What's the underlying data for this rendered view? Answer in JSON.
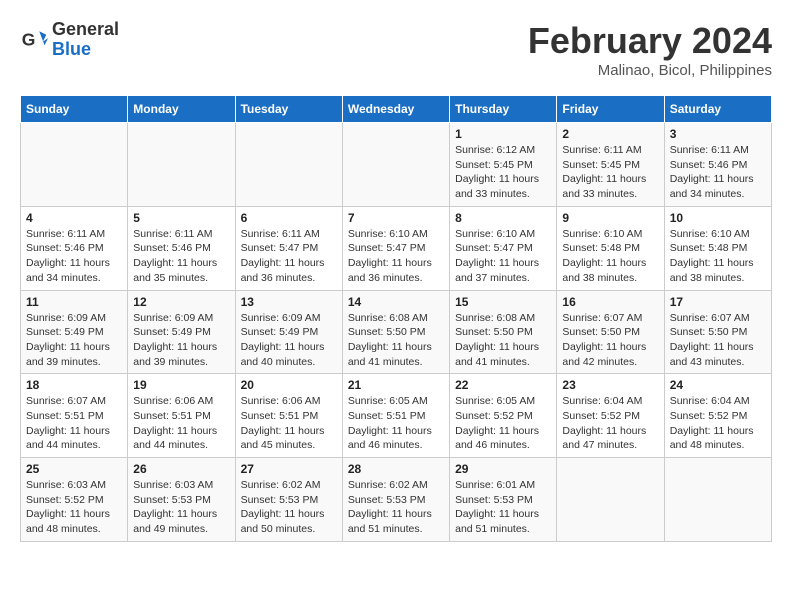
{
  "header": {
    "logo_line1": "General",
    "logo_line2": "Blue",
    "main_title": "February 2024",
    "subtitle": "Malinao, Bicol, Philippines"
  },
  "calendar": {
    "days_of_week": [
      "Sunday",
      "Monday",
      "Tuesday",
      "Wednesday",
      "Thursday",
      "Friday",
      "Saturday"
    ],
    "weeks": [
      [
        {
          "day": "",
          "details": ""
        },
        {
          "day": "",
          "details": ""
        },
        {
          "day": "",
          "details": ""
        },
        {
          "day": "",
          "details": ""
        },
        {
          "day": "1",
          "details": "Sunrise: 6:12 AM\nSunset: 5:45 PM\nDaylight: 11 hours and 33 minutes."
        },
        {
          "day": "2",
          "details": "Sunrise: 6:11 AM\nSunset: 5:45 PM\nDaylight: 11 hours and 33 minutes."
        },
        {
          "day": "3",
          "details": "Sunrise: 6:11 AM\nSunset: 5:46 PM\nDaylight: 11 hours and 34 minutes."
        }
      ],
      [
        {
          "day": "4",
          "details": "Sunrise: 6:11 AM\nSunset: 5:46 PM\nDaylight: 11 hours and 34 minutes."
        },
        {
          "day": "5",
          "details": "Sunrise: 6:11 AM\nSunset: 5:46 PM\nDaylight: 11 hours and 35 minutes."
        },
        {
          "day": "6",
          "details": "Sunrise: 6:11 AM\nSunset: 5:47 PM\nDaylight: 11 hours and 36 minutes."
        },
        {
          "day": "7",
          "details": "Sunrise: 6:10 AM\nSunset: 5:47 PM\nDaylight: 11 hours and 36 minutes."
        },
        {
          "day": "8",
          "details": "Sunrise: 6:10 AM\nSunset: 5:47 PM\nDaylight: 11 hours and 37 minutes."
        },
        {
          "day": "9",
          "details": "Sunrise: 6:10 AM\nSunset: 5:48 PM\nDaylight: 11 hours and 38 minutes."
        },
        {
          "day": "10",
          "details": "Sunrise: 6:10 AM\nSunset: 5:48 PM\nDaylight: 11 hours and 38 minutes."
        }
      ],
      [
        {
          "day": "11",
          "details": "Sunrise: 6:09 AM\nSunset: 5:49 PM\nDaylight: 11 hours and 39 minutes."
        },
        {
          "day": "12",
          "details": "Sunrise: 6:09 AM\nSunset: 5:49 PM\nDaylight: 11 hours and 39 minutes."
        },
        {
          "day": "13",
          "details": "Sunrise: 6:09 AM\nSunset: 5:49 PM\nDaylight: 11 hours and 40 minutes."
        },
        {
          "day": "14",
          "details": "Sunrise: 6:08 AM\nSunset: 5:50 PM\nDaylight: 11 hours and 41 minutes."
        },
        {
          "day": "15",
          "details": "Sunrise: 6:08 AM\nSunset: 5:50 PM\nDaylight: 11 hours and 41 minutes."
        },
        {
          "day": "16",
          "details": "Sunrise: 6:07 AM\nSunset: 5:50 PM\nDaylight: 11 hours and 42 minutes."
        },
        {
          "day": "17",
          "details": "Sunrise: 6:07 AM\nSunset: 5:50 PM\nDaylight: 11 hours and 43 minutes."
        }
      ],
      [
        {
          "day": "18",
          "details": "Sunrise: 6:07 AM\nSunset: 5:51 PM\nDaylight: 11 hours and 44 minutes."
        },
        {
          "day": "19",
          "details": "Sunrise: 6:06 AM\nSunset: 5:51 PM\nDaylight: 11 hours and 44 minutes."
        },
        {
          "day": "20",
          "details": "Sunrise: 6:06 AM\nSunset: 5:51 PM\nDaylight: 11 hours and 45 minutes."
        },
        {
          "day": "21",
          "details": "Sunrise: 6:05 AM\nSunset: 5:51 PM\nDaylight: 11 hours and 46 minutes."
        },
        {
          "day": "22",
          "details": "Sunrise: 6:05 AM\nSunset: 5:52 PM\nDaylight: 11 hours and 46 minutes."
        },
        {
          "day": "23",
          "details": "Sunrise: 6:04 AM\nSunset: 5:52 PM\nDaylight: 11 hours and 47 minutes."
        },
        {
          "day": "24",
          "details": "Sunrise: 6:04 AM\nSunset: 5:52 PM\nDaylight: 11 hours and 48 minutes."
        }
      ],
      [
        {
          "day": "25",
          "details": "Sunrise: 6:03 AM\nSunset: 5:52 PM\nDaylight: 11 hours and 48 minutes."
        },
        {
          "day": "26",
          "details": "Sunrise: 6:03 AM\nSunset: 5:53 PM\nDaylight: 11 hours and 49 minutes."
        },
        {
          "day": "27",
          "details": "Sunrise: 6:02 AM\nSunset: 5:53 PM\nDaylight: 11 hours and 50 minutes."
        },
        {
          "day": "28",
          "details": "Sunrise: 6:02 AM\nSunset: 5:53 PM\nDaylight: 11 hours and 51 minutes."
        },
        {
          "day": "29",
          "details": "Sunrise: 6:01 AM\nSunset: 5:53 PM\nDaylight: 11 hours and 51 minutes."
        },
        {
          "day": "",
          "details": ""
        },
        {
          "day": "",
          "details": ""
        }
      ]
    ]
  }
}
